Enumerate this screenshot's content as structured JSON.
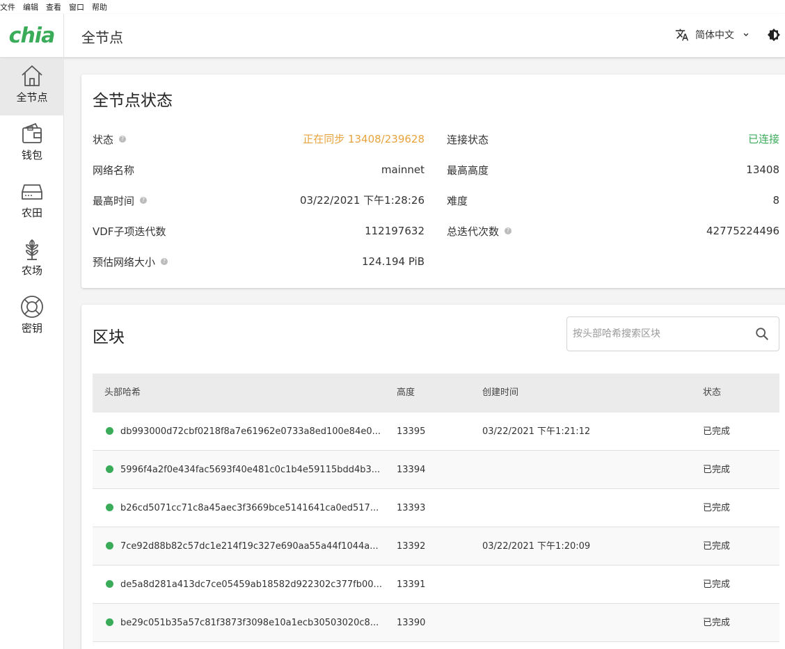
{
  "menu": [
    "文件",
    "编辑",
    "查看",
    "窗口",
    "帮助"
  ],
  "header": {
    "logo": "chia",
    "title": "全节点",
    "language": "简体中文"
  },
  "sidebar": [
    {
      "label": "全节点",
      "icon": "home-icon",
      "active": true
    },
    {
      "label": "钱包",
      "icon": "wallet-icon",
      "active": false
    },
    {
      "label": "农田",
      "icon": "harddrive-icon",
      "active": false
    },
    {
      "label": "农场",
      "icon": "plant-icon",
      "active": false
    },
    {
      "label": "密钥",
      "icon": "lifebuoy-icon",
      "active": false
    }
  ],
  "status": {
    "title": "全节点状态",
    "left": [
      {
        "label": "状态",
        "value": "正在同步 13408/239628",
        "help": true
      },
      {
        "label": "网络名称",
        "value": "mainnet",
        "help": false
      },
      {
        "label": "最高时间",
        "value": "03/22/2021 下午1:28:26",
        "help": true
      },
      {
        "label": "VDF子项迭代数",
        "value": "112197632",
        "help": false
      },
      {
        "label": "预估网络大小",
        "value": "124.194 PiB",
        "help": true
      }
    ],
    "right": [
      {
        "label": "连接状态",
        "value": "已连接",
        "help": false
      },
      {
        "label": "最高高度",
        "value": "13408",
        "help": false
      },
      {
        "label": "难度",
        "value": "8",
        "help": false
      },
      {
        "label": "总迭代次数",
        "value": "42775224496",
        "help": true
      }
    ],
    "colors": {
      "syncing": "#e8a33d",
      "connected": "#3aac59"
    }
  },
  "blocks": {
    "title": "区块",
    "search_placeholder": "按头部哈希搜索区块",
    "columns": [
      "头部哈希",
      "高度",
      "创建时间",
      "状态"
    ],
    "rows": [
      {
        "hash": "db993000d72cbf0218f8a7e61962e0733a8ed100e84e0...",
        "height": "13395",
        "time": "03/22/2021 下午1:21:12",
        "state": "已完成"
      },
      {
        "hash": "5996f4a2f0e434fac5693f40e481c0c1b4e59115bdd4b3...",
        "height": "13394",
        "time": "",
        "state": "已完成"
      },
      {
        "hash": "b26cd5071cc71c8a45aec3f3669bce5141641ca0ed517...",
        "height": "13393",
        "time": "",
        "state": "已完成"
      },
      {
        "hash": "7ce92d88b82c57dc1e214f19c327e690aa55a44f1044a...",
        "height": "13392",
        "time": "03/22/2021 下午1:20:09",
        "state": "已完成"
      },
      {
        "hash": "de5a8d281a413dc7ce05459ab18582d922302c377fb00...",
        "height": "13391",
        "time": "",
        "state": "已完成"
      },
      {
        "hash": "be29c051b35a57c81f3873f3098e10a1ecb30503020c8...",
        "height": "13390",
        "time": "",
        "state": "已完成"
      }
    ]
  }
}
